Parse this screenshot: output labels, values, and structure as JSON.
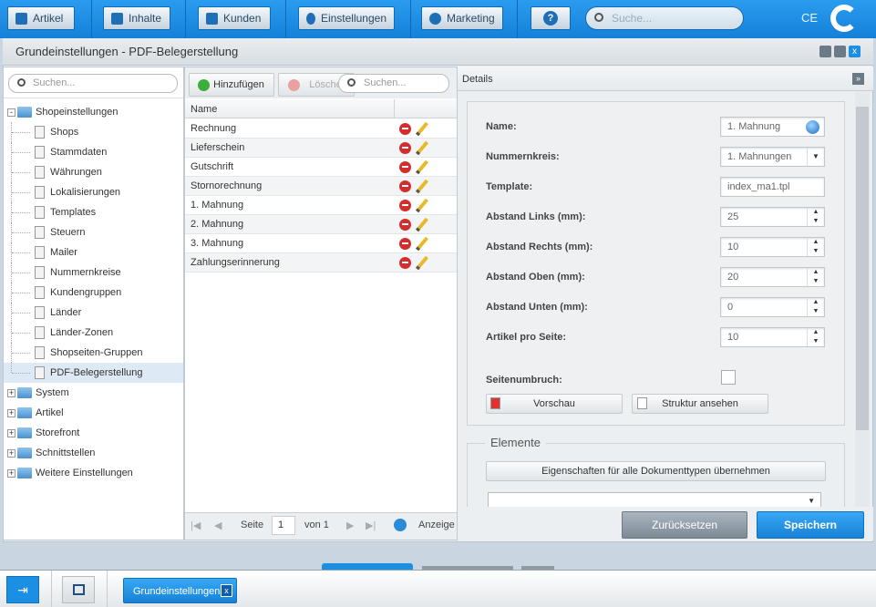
{
  "topnav": {
    "items": [
      {
        "label": "Artikel",
        "icon": "inbox-icon"
      },
      {
        "label": "Inhalte",
        "icon": "document-icon"
      },
      {
        "label": "Kunden",
        "icon": "users-icon"
      },
      {
        "label": "Einstellungen",
        "icon": "gear-icon"
      },
      {
        "label": "Marketing",
        "icon": "pie-chart-icon"
      }
    ],
    "help": "?",
    "search_placeholder": "Suche...",
    "user_initials": "CE"
  },
  "window": {
    "title": "Grundeinstellungen - PDF-Belegerstellung"
  },
  "tree": {
    "search_placeholder": "Suchen...",
    "root": "Shopeinstellungen",
    "children": [
      "Shops",
      "Stammdaten",
      "Währungen",
      "Lokalisierungen",
      "Templates",
      "Steuern",
      "Mailer",
      "Nummernkreise",
      "Kundengruppen",
      "Länder",
      "Länder-Zonen",
      "Shopseiten-Gruppen",
      "PDF-Belegerstellung"
    ],
    "selected": "PDF-Belegerstellung",
    "folders": [
      "System",
      "Artikel",
      "Storefront",
      "Schnittstellen",
      "Weitere Einstellungen"
    ]
  },
  "grid": {
    "add_label": "Hinzufügen",
    "delete_label": "Lösche",
    "search_placeholder": "Suchen...",
    "column": "Name",
    "rows": [
      "Rechnung",
      "Lieferschein",
      "Gutschrift",
      "Stornorechnung",
      "1. Mahnung",
      "2. Mahnung",
      "3. Mahnung",
      "Zahlungserinnerung"
    ],
    "paging": {
      "page_label": "Seite",
      "page": "1",
      "of_label": "von 1",
      "display_label": "Anzeige"
    }
  },
  "details": {
    "title": "Details",
    "fields": [
      {
        "label": "Name:",
        "value": "1. Mahnung"
      },
      {
        "label": "Nummernkreis:",
        "value": "1. Mahnungen"
      },
      {
        "label": "Template:",
        "value": "index_ma1.tpl"
      },
      {
        "label": "Abstand Links (mm):",
        "value": "25"
      },
      {
        "label": "Abstand Rechts (mm):",
        "value": "10"
      },
      {
        "label": "Abstand Oben (mm):",
        "value": "20"
      },
      {
        "label": "Abstand Unten (mm):",
        "value": "0"
      },
      {
        "label": "Artikel pro Seite:",
        "value": "10"
      }
    ],
    "pagebreak_label": "Seitenumbruch:",
    "pagebreak_checked": false,
    "preview_label": "Vorschau",
    "structure_label": "Struktur ansehen",
    "elements_legend": "Elemente",
    "apply_all_label": "Eigenschaften für alle Dokumenttypen übernehmen",
    "reset_label": "Zurücksetzen",
    "save_label": "Speichern"
  },
  "taskbar": {
    "tab_label": "Grundeinstellungen",
    "tab_close": "x"
  },
  "colors": {
    "accent": "#1a8fe3",
    "selected_row": "#dde9f5"
  }
}
